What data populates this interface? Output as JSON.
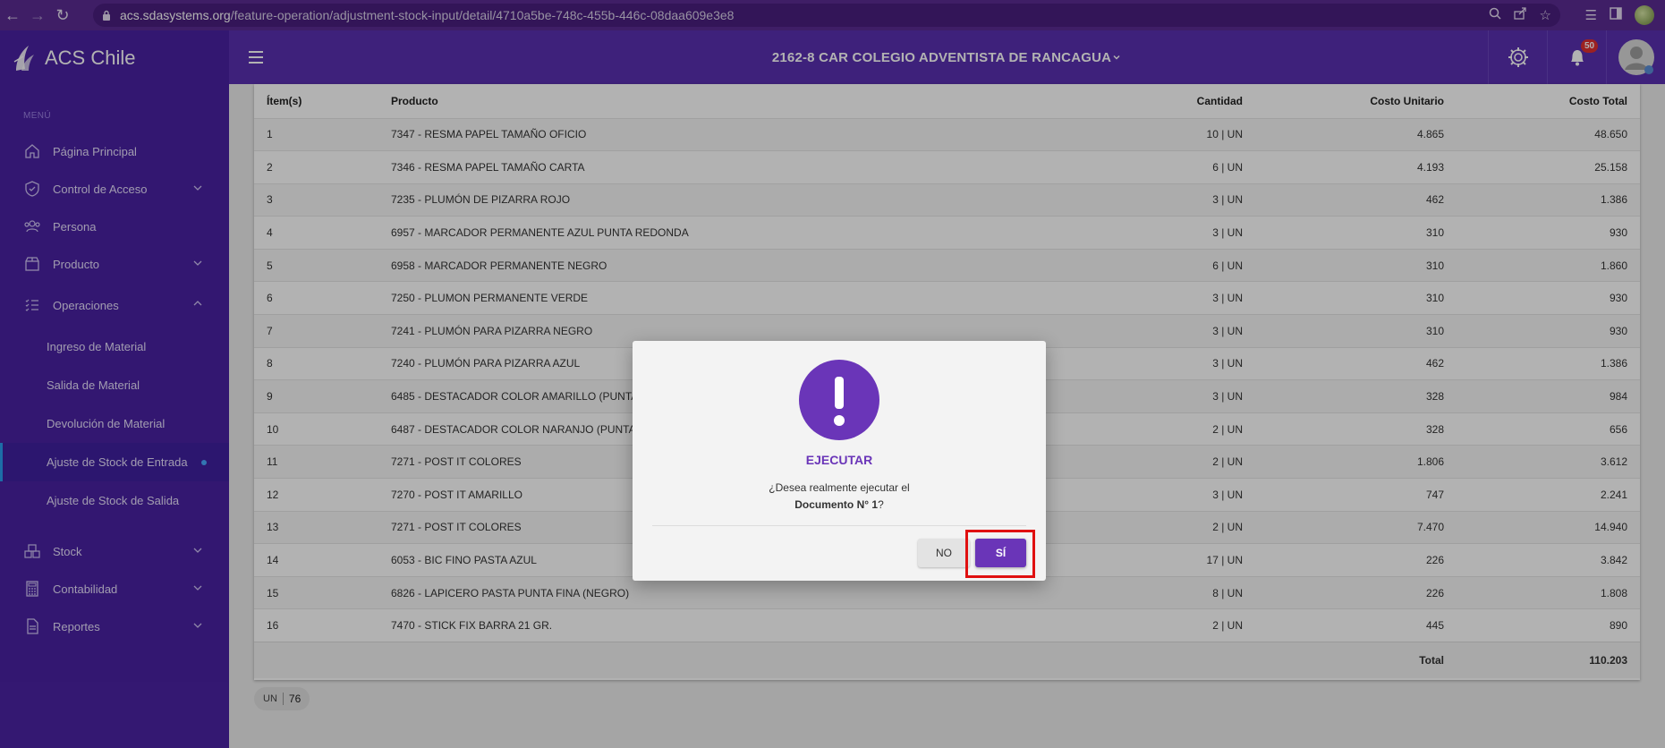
{
  "browser": {
    "url_host": "acs.sdasystems.org",
    "url_path": "/feature-operation/adjustment-stock-input/detail/4710a5be-748c-455b-446c-08daa609e3e8"
  },
  "sidebar": {
    "brand": "ACS Chile",
    "menu_heading": "MENÚ",
    "items": [
      {
        "label": "Página Principal",
        "icon": "home-icon"
      },
      {
        "label": "Control de Acceso",
        "icon": "shield-icon"
      },
      {
        "label": "Persona",
        "icon": "people-icon"
      },
      {
        "label": "Producto",
        "icon": "box-icon"
      },
      {
        "label": "Operaciones",
        "icon": "list-icon"
      },
      {
        "label": "Stock",
        "icon": "stock-icon"
      },
      {
        "label": "Contabilidad",
        "icon": "calculator-icon"
      },
      {
        "label": "Reportes",
        "icon": "document-icon"
      }
    ],
    "sub_items": [
      "Ingreso de Material",
      "Salida de Material",
      "Devolución de Material",
      "Ajuste de Stock de Entrada",
      "Ajuste de Stock de Salida"
    ]
  },
  "header": {
    "school": "2162-8 CAR COLEGIO ADVENTISTA DE RANCAGUA",
    "notifications": "50"
  },
  "table": {
    "headers": [
      "Ítem(s)",
      "Producto",
      "Cantidad",
      "Costo Unitario",
      "Costo Total"
    ],
    "rows": [
      [
        "1",
        "7347 - RESMA PAPEL TAMAÑO OFICIO",
        "10 | UN",
        "4.865",
        "48.650"
      ],
      [
        "2",
        "7346 - RESMA PAPEL TAMAÑO CARTA",
        "6 | UN",
        "4.193",
        "25.158"
      ],
      [
        "3",
        "7235 - PLUMÓN DE PIZARRA ROJO",
        "3 | UN",
        "462",
        "1.386"
      ],
      [
        "4",
        "6957 - MARCADOR PERMANENTE AZUL PUNTA REDONDA",
        "3 | UN",
        "310",
        "930"
      ],
      [
        "5",
        "6958 - MARCADOR PERMANENTE NEGRO",
        "6 | UN",
        "310",
        "1.860"
      ],
      [
        "6",
        "7250 - PLUMON PERMANENTE VERDE",
        "3 | UN",
        "310",
        "930"
      ],
      [
        "7",
        "7241 - PLUMÓN PARA PIZARRA NEGRO",
        "3 | UN",
        "310",
        "930"
      ],
      [
        "8",
        "7240 - PLUMÓN PARA PIZARRA AZUL",
        "3 | UN",
        "462",
        "1.386"
      ],
      [
        "9",
        "6485 - DESTACADOR COLOR AMARILLO (PUNTA",
        "3 | UN",
        "328",
        "984"
      ],
      [
        "10",
        "6487 - DESTACADOR COLOR NARANJO (PUNTA",
        "2 | UN",
        "328",
        "656"
      ],
      [
        "11",
        "7271 - POST IT COLORES",
        "2 | UN",
        "1.806",
        "3.612"
      ],
      [
        "12",
        "7270 - POST IT AMARILLO",
        "3 | UN",
        "747",
        "2.241"
      ],
      [
        "13",
        "7271 - POST IT COLORES",
        "2 | UN",
        "7.470",
        "14.940"
      ],
      [
        "14",
        "6053 - BIC FINO PASTA AZUL",
        "17 | UN",
        "226",
        "3.842"
      ],
      [
        "15",
        "6826 - LAPICERO PASTA PUNTA FINA (NEGRO)",
        "8 | UN",
        "226",
        "1.808"
      ],
      [
        "16",
        "7470 - STICK FIX BARRA 21 GR.",
        "2 | UN",
        "445",
        "890"
      ]
    ],
    "total_label": "Total",
    "total_value": "110.203"
  },
  "summary_chip": {
    "unit": "UN",
    "count": "76"
  },
  "modal": {
    "title": "EJECUTAR",
    "question": "¿Desea realmente ejecutar el",
    "document": "Documento N° 1",
    "question_end": "?",
    "no_label": "NO",
    "yes_label": "SÍ"
  },
  "colors": {
    "primary": "#4a22a3",
    "header": "#5a30b0",
    "accent": "#6a35b8",
    "highlight": "#e01010",
    "badge": "#e03030"
  }
}
